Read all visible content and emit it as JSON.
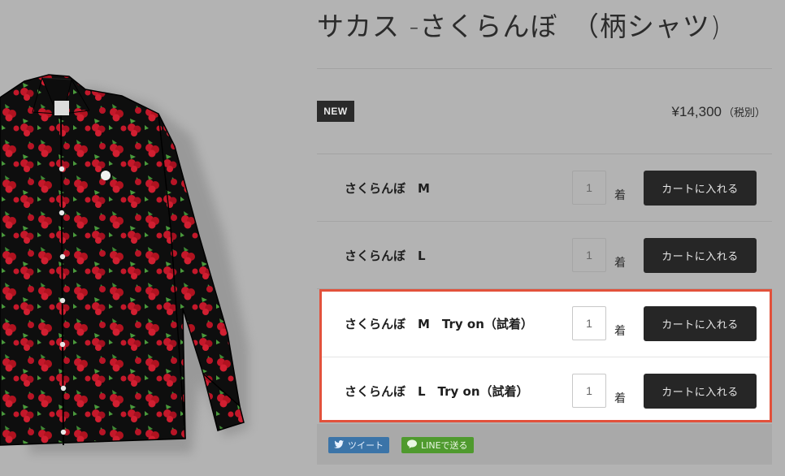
{
  "product": {
    "title": "サカス -さくらんぼ　（柄シャツ)",
    "badge": "NEW",
    "price": "¥14,300",
    "tax_note": "（税別）",
    "image_alt": "cherry-print-shirt"
  },
  "variants": [
    {
      "name": "さくらんぼ　M",
      "qty": "1",
      "unit": "着",
      "button": "カートに入れる"
    },
    {
      "name": "さくらんぼ　L",
      "qty": "1",
      "unit": "着",
      "button": "カートに入れる"
    },
    {
      "name": "さくらんぼ　M　Try on（試着）",
      "qty": "1",
      "unit": "着",
      "button": "カートに入れる"
    },
    {
      "name": "さくらんぼ　L　Try on（試着）",
      "qty": "1",
      "unit": "着",
      "button": "カートに入れる"
    }
  ],
  "share": {
    "tweet_label": "ツイート",
    "line_label": "LINEで送る",
    "tweet_icon": "twitter-bird-icon",
    "line_icon": "line-chat-icon"
  },
  "colors": {
    "highlight_border": "#e2513b",
    "button_bg": "#262626",
    "tweet_bg": "#3b74a8",
    "line_bg": "#4f9a2e"
  }
}
